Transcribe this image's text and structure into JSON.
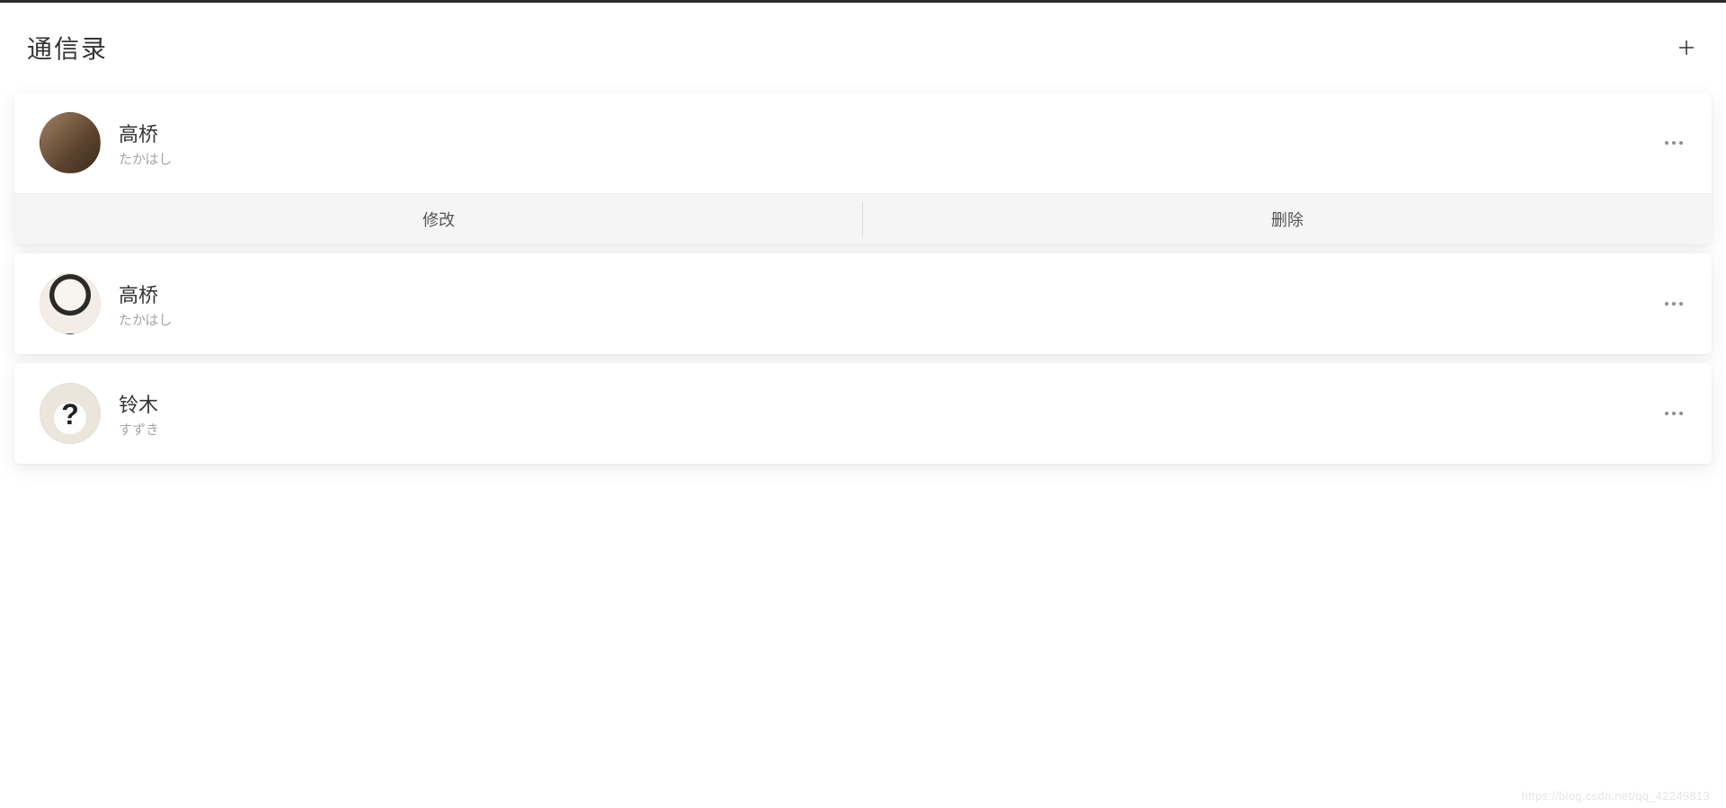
{
  "header": {
    "title": "通信录"
  },
  "contacts": [
    {
      "name": "高桥",
      "sub": "たかはし",
      "expanded": true,
      "actions": {
        "edit": "修改",
        "delete": "删除"
      }
    },
    {
      "name": "高桥",
      "sub": "たかはし",
      "expanded": false
    },
    {
      "name": "铃木",
      "sub": "すずき",
      "expanded": false
    }
  ],
  "watermark": "https://blog.csdn.net/qq_42249813"
}
